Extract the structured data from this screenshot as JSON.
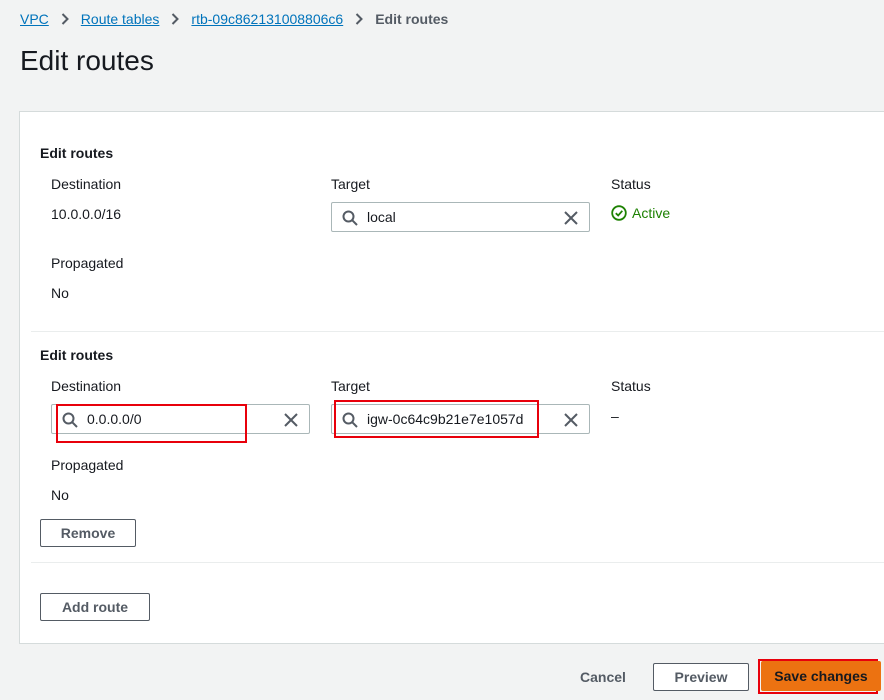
{
  "breadcrumb": {
    "items": [
      "VPC",
      "Route tables",
      "rtb-09c862131008806c6"
    ],
    "current": "Edit routes"
  },
  "page_title": "Edit routes",
  "routes": [
    {
      "section_title": "Edit routes",
      "destination_label": "Destination",
      "destination_value": "10.0.0.0/16",
      "target_label": "Target",
      "target_value": "local",
      "status_label": "Status",
      "status_value": "Active",
      "propagated_label": "Propagated",
      "propagated_value": "No"
    },
    {
      "section_title": "Edit routes",
      "destination_label": "Destination",
      "destination_value": "0.0.0.0/0",
      "target_label": "Target",
      "target_value": "igw-0c64c9b21e7e1057d",
      "status_label": "Status",
      "status_value": "–",
      "propagated_label": "Propagated",
      "propagated_value": "No",
      "remove_label": "Remove"
    }
  ],
  "add_route_label": "Add route",
  "footer": {
    "cancel_label": "Cancel",
    "preview_label": "Preview",
    "save_label": "Save changes"
  },
  "colors": {
    "link": "#0073bb",
    "primary": "#ec7211",
    "success": "#1d8102",
    "highlight": "#e8000b"
  },
  "icons": [
    "chevron-right-icon",
    "search-icon",
    "clear-icon",
    "check-circle-icon"
  ]
}
